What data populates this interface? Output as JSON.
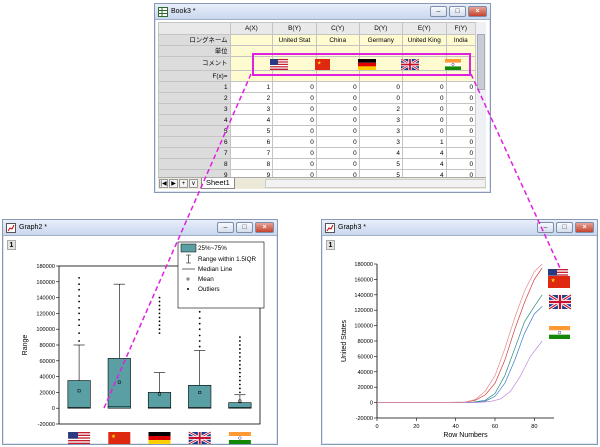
{
  "book": {
    "title": "Book3 *",
    "columns": [
      "A(X)",
      "B(Y)",
      "C(Y)",
      "D(Y)",
      "E(Y)",
      "F(Y)"
    ],
    "row_labels": [
      "ロングネーム",
      "単位",
      "コメント",
      "F(x)="
    ],
    "long_names": [
      "",
      "United Stat",
      "China",
      "Germany",
      "United King",
      "India"
    ],
    "rows": [
      [
        "1",
        "1",
        "0",
        "0",
        "0",
        "0"
      ],
      [
        "2",
        "2",
        "0",
        "0",
        "0",
        "0"
      ],
      [
        "3",
        "3",
        "0",
        "0",
        "2",
        "0"
      ],
      [
        "4",
        "4",
        "0",
        "0",
        "3",
        "0"
      ],
      [
        "5",
        "5",
        "0",
        "0",
        "3",
        "0"
      ],
      [
        "6",
        "6",
        "0",
        "0",
        "3",
        "1"
      ],
      [
        "7",
        "7",
        "0",
        "0",
        "4",
        "4"
      ],
      [
        "8",
        "8",
        "0",
        "0",
        "5",
        "4"
      ],
      [
        "9",
        "9",
        "0",
        "0",
        "5",
        "4"
      ],
      [
        "10",
        "10",
        "2",
        "0",
        "5",
        "5"
      ]
    ],
    "row_tail": [
      "0",
      "0",
      "0",
      "0",
      "0",
      "0",
      "0",
      "0",
      "0",
      "2"
    ],
    "sheet_tab": "Sheet1",
    "nav_buttons": [
      "|◀",
      "▶",
      "+",
      "∨"
    ]
  },
  "graph2": {
    "title": "Graph2 *",
    "layer": "1",
    "ylabel": "Range",
    "legend": [
      "25%~75%",
      "Range within 1.5IQR",
      "Median Line",
      "Mean",
      "Outliers"
    ]
  },
  "graph3": {
    "title": "Graph3 *",
    "layer": "1",
    "ylabel": "United States",
    "xlabel": "Row Numbers"
  },
  "window_buttons": {
    "min": "–",
    "max": "□",
    "close": "×"
  },
  "colors": {
    "highlight": "#e020e0",
    "box_fill": "#5a9fa3",
    "title_grad": "#c9d7ee"
  },
  "chart_data": [
    {
      "type": "box",
      "categories": [
        "US",
        "CN",
        "DE",
        "UK",
        "IN"
      ],
      "ylim": [
        -20000,
        180000
      ],
      "yticks": [
        "-20000",
        "0",
        "20000",
        "40000",
        "60000",
        "80000",
        "100000",
        "120000",
        "140000",
        "160000",
        "180000"
      ],
      "series": [
        {
          "values": {
            "q1": 0,
            "median": 1000,
            "q3": 35000,
            "whisker_low": 0,
            "whisker_high": 80000,
            "mean": 22000
          }
        },
        {
          "values": {
            "q1": 0,
            "median": 2000,
            "q3": 63000,
            "whisker_low": 0,
            "whisker_high": 157000,
            "mean": 33000
          }
        },
        {
          "values": {
            "q1": 0,
            "median": 1000,
            "q3": 20000,
            "whisker_low": 0,
            "whisker_high": 45000,
            "mean": 18000
          }
        },
        {
          "values": {
            "q1": 0,
            "median": 1000,
            "q3": 29000,
            "whisker_low": 0,
            "whisker_high": 73000,
            "mean": 20000
          }
        },
        {
          "values": {
            "q1": 0,
            "median": 1000,
            "q3": 7000,
            "whisker_low": 0,
            "whisker_high": 17000,
            "mean": 9000
          }
        }
      ],
      "outliers": [
        [
          85000,
          95000,
          105000,
          112000,
          120000,
          127000,
          135000,
          142000,
          150000,
          157000,
          165000
        ],
        [],
        [
          95000,
          100000,
          105000,
          110000,
          115000,
          120000,
          125000,
          130000,
          135000,
          140000
        ],
        [
          78000,
          85000,
          92000,
          100000,
          107000,
          114000,
          122000,
          128000
        ],
        [
          20000,
          25000,
          30000,
          35000,
          40000,
          45000,
          50000,
          55000,
          60000,
          65000,
          70000,
          75000,
          80000,
          85000,
          90000
        ]
      ]
    },
    {
      "type": "line",
      "xlim": [
        0,
        90
      ],
      "ylim": [
        -20000,
        180000
      ],
      "xticks": [
        "0",
        "20",
        "40",
        "60",
        "80"
      ],
      "yticks": [
        "-20000",
        "0",
        "20000",
        "40000",
        "60000",
        "80000",
        "100000",
        "120000",
        "140000",
        "160000",
        "180000"
      ],
      "series": [
        {
          "color": "#d73a3a",
          "x": [
            0,
            30,
            45,
            50,
            55,
            60,
            65,
            70,
            75,
            80,
            84
          ],
          "y": [
            0,
            0,
            500,
            3000,
            10000,
            25000,
            55000,
            95000,
            130000,
            160000,
            175000
          ]
        },
        {
          "color": "#2d8a7a",
          "x": [
            0,
            30,
            48,
            55,
            60,
            65,
            70,
            75,
            80,
            84
          ],
          "y": [
            0,
            0,
            300,
            3000,
            12000,
            35000,
            70000,
            105000,
            125000,
            140000
          ]
        },
        {
          "color": "#3a7ad0",
          "x": [
            0,
            30,
            50,
            55,
            60,
            65,
            70,
            75,
            80,
            84
          ],
          "y": [
            0,
            0,
            300,
            2000,
            8000,
            25000,
            55000,
            90000,
            115000,
            125000
          ]
        },
        {
          "color": "#c28ad8",
          "x": [
            0,
            30,
            52,
            58,
            63,
            68,
            73,
            78,
            84
          ],
          "y": [
            0,
            0,
            200,
            1500,
            5000,
            15000,
            35000,
            60000,
            80000
          ]
        },
        {
          "color": "#e38b8b",
          "x": [
            0,
            30,
            45,
            50,
            55,
            60,
            65,
            70,
            75,
            80,
            84
          ],
          "y": [
            0,
            0,
            800,
            4000,
            15000,
            35000,
            70000,
            110000,
            145000,
            170000,
            180000
          ]
        }
      ]
    }
  ]
}
